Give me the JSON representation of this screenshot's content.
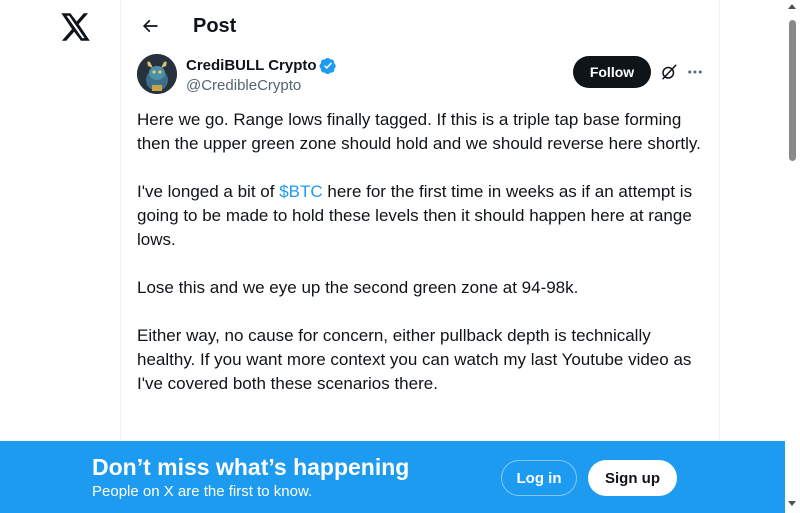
{
  "nav": {
    "logo_icon": "x-logo-icon"
  },
  "header": {
    "back_icon": "arrow-left-icon",
    "title": "Post"
  },
  "author": {
    "name": "CrediBULL Crypto",
    "handle": "@CredibleCrypto",
    "verified_icon": "verified-badge-icon",
    "verified_color": "#1d9bf0"
  },
  "actions": {
    "follow_label": "Follow",
    "grok_icon": "grok-icon",
    "more_icon": "more-horizontal-icon"
  },
  "tweet": {
    "paragraph_1": "Here we go. Range lows finally tagged. If this is a triple tap base forming then the upper green zone should hold and we should reverse here shortly.",
    "paragraph_2_before": "I've longed a bit of ",
    "cashtag": "$BTC",
    "paragraph_2_after": " here for the first time in weeks as if an attempt is going to be made to hold these levels then it should happen here at range lows.",
    "paragraph_3": "Lose this and we eye up the second green zone at 94-98k.",
    "paragraph_4": "Either way, no cause for concern, either pullback depth is technically healthy. If you want more context you can watch my last Youtube video as I've covered both these scenarios there.",
    "cashtag_color": "#1d9bf0"
  },
  "banner": {
    "title": "Don’t miss what’s happening",
    "subtitle": "People on X are the first to know.",
    "login_label": "Log in",
    "signup_label": "Sign up",
    "background": "#1d9bf0"
  }
}
